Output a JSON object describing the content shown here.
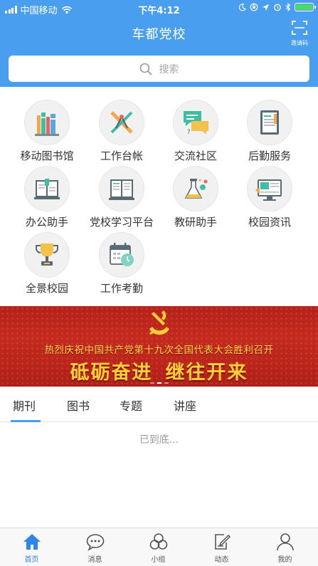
{
  "status_bar": {
    "carrier": "中国移动",
    "time": "下午4:12"
  },
  "header": {
    "title": "车都党校",
    "invite_label": "邀请码"
  },
  "search": {
    "placeholder": "搜索",
    "icon": "search-icon"
  },
  "grid": {
    "items": [
      {
        "label": "移动图书馆",
        "icon": "bookshelf-icon"
      },
      {
        "label": "工作台帐",
        "icon": "drafting-tools-icon"
      },
      {
        "label": "交流社区",
        "icon": "chat-bubbles-icon"
      },
      {
        "label": "后勤服务",
        "icon": "document-list-icon"
      },
      {
        "label": "办公助手",
        "icon": "open-book-icon"
      },
      {
        "label": "党校学习平台",
        "icon": "book-text-icon"
      },
      {
        "label": "教研助手",
        "icon": "lab-flask-icon"
      },
      {
        "label": "校园资讯",
        "icon": "news-monitor-icon"
      },
      {
        "label": "全景校园",
        "icon": "trophy-icon"
      },
      {
        "label": "工作考勤",
        "icon": "calendar-clock-icon"
      }
    ]
  },
  "banner": {
    "line1": "热烈庆祝中国共产党第十九次全国代表大会胜利召开",
    "line2_part1": "砥砺奋进",
    "line2_part2": "继往开来"
  },
  "tabs": {
    "items": [
      "期刊",
      "图书",
      "专题",
      "讲座"
    ],
    "active_index": 0
  },
  "content": {
    "end_text": "已到底..."
  },
  "bottom_nav": {
    "items": [
      {
        "label": "首页",
        "icon": "home-icon"
      },
      {
        "label": "消息",
        "icon": "message-bubble-icon"
      },
      {
        "label": "小组",
        "icon": "group-circles-icon"
      },
      {
        "label": "动态",
        "icon": "edit-note-icon"
      },
      {
        "label": "我的",
        "icon": "user-icon"
      }
    ],
    "active_index": 0
  },
  "colors": {
    "header_blue": "#4a9eef",
    "accent_blue": "#2f86e8",
    "banner_red": "#c42a1e",
    "banner_gold": "#ffcf3a"
  }
}
